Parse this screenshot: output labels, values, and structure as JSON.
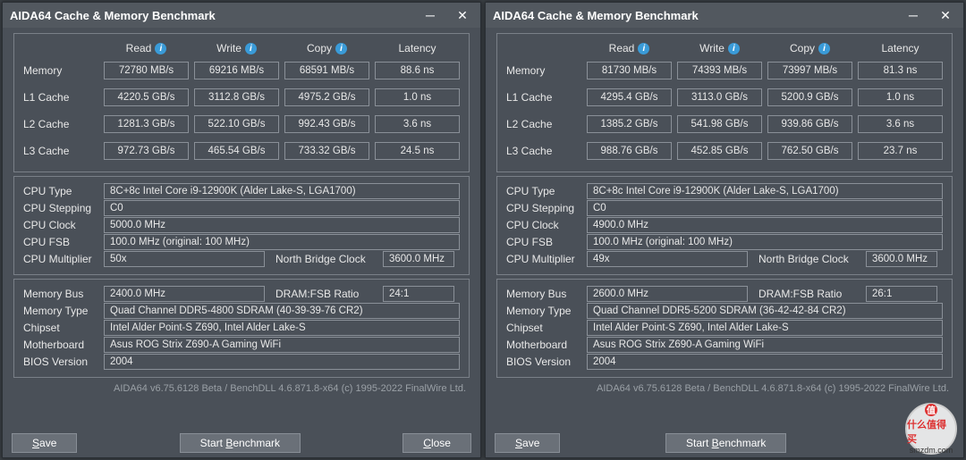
{
  "app_title": "AIDA64 Cache & Memory Benchmark",
  "col_headers": {
    "read": "Read",
    "write": "Write",
    "copy": "Copy",
    "latency": "Latency"
  },
  "cache_labels": {
    "memory": "Memory",
    "l1": "L1 Cache",
    "l2": "L2 Cache",
    "l3": "L3 Cache"
  },
  "info_labels": {
    "cpu_type": "CPU Type",
    "cpu_stepping": "CPU Stepping",
    "cpu_clock": "CPU Clock",
    "cpu_fsb": "CPU FSB",
    "cpu_mult": "CPU Multiplier",
    "nb_clock": "North Bridge Clock",
    "mem_bus": "Memory Bus",
    "dram_fsb": "DRAM:FSB Ratio",
    "mem_type": "Memory Type",
    "chipset": "Chipset",
    "motherboard": "Motherboard",
    "bios": "BIOS Version"
  },
  "footer": "AIDA64 v6.75.6128 Beta / BenchDLL 4.6.871.8-x64  (c) 1995-2022 FinalWire Ltd.",
  "buttons": {
    "save": "Save",
    "start": "Start Benchmark",
    "close": "Close"
  },
  "watermark": {
    "zh": "什么值得买",
    "en": "smzdm.com"
  },
  "left": {
    "rows": {
      "memory": {
        "read": "72780 MB/s",
        "write": "69216 MB/s",
        "copy": "68591 MB/s",
        "latency": "88.6 ns"
      },
      "l1": {
        "read": "4220.5 GB/s",
        "write": "3112.8 GB/s",
        "copy": "4975.2 GB/s",
        "latency": "1.0 ns"
      },
      "l2": {
        "read": "1281.3 GB/s",
        "write": "522.10 GB/s",
        "copy": "992.43 GB/s",
        "latency": "3.6 ns"
      },
      "l3": {
        "read": "972.73 GB/s",
        "write": "465.54 GB/s",
        "copy": "733.32 GB/s",
        "latency": "24.5 ns"
      }
    },
    "info": {
      "cpu_type": "8C+8c Intel Core i9-12900K (Alder Lake-S, LGA1700)",
      "cpu_stepping": "C0",
      "cpu_clock": "5000.0 MHz",
      "cpu_fsb": "100.0 MHz  (original: 100 MHz)",
      "cpu_mult": "50x",
      "nb_clock": "3600.0 MHz",
      "mem_bus": "2400.0 MHz",
      "dram_fsb": "24:1",
      "mem_type": "Quad Channel DDR5-4800 SDRAM  (40-39-39-76 CR2)",
      "chipset": "Intel Alder Point-S Z690, Intel Alder Lake-S",
      "motherboard": "Asus ROG Strix Z690-A Gaming WiFi",
      "bios": "2004"
    }
  },
  "right": {
    "rows": {
      "memory": {
        "read": "81730 MB/s",
        "write": "74393 MB/s",
        "copy": "73997 MB/s",
        "latency": "81.3 ns"
      },
      "l1": {
        "read": "4295.4 GB/s",
        "write": "3113.0 GB/s",
        "copy": "5200.9 GB/s",
        "latency": "1.0 ns"
      },
      "l2": {
        "read": "1385.2 GB/s",
        "write": "541.98 GB/s",
        "copy": "939.86 GB/s",
        "latency": "3.6 ns"
      },
      "l3": {
        "read": "988.76 GB/s",
        "write": "452.85 GB/s",
        "copy": "762.50 GB/s",
        "latency": "23.7 ns"
      }
    },
    "info": {
      "cpu_type": "8C+8c Intel Core i9-12900K (Alder Lake-S, LGA1700)",
      "cpu_stepping": "C0",
      "cpu_clock": "4900.0 MHz",
      "cpu_fsb": "100.0 MHz  (original: 100 MHz)",
      "cpu_mult": "49x",
      "nb_clock": "3600.0 MHz",
      "mem_bus": "2600.0 MHz",
      "dram_fsb": "26:1",
      "mem_type": "Quad Channel DDR5-5200 SDRAM  (36-42-42-84 CR2)",
      "chipset": "Intel Alder Point-S Z690, Intel Alder Lake-S",
      "motherboard": "Asus ROG Strix Z690-A Gaming WiFi",
      "bios": "2004"
    }
  }
}
